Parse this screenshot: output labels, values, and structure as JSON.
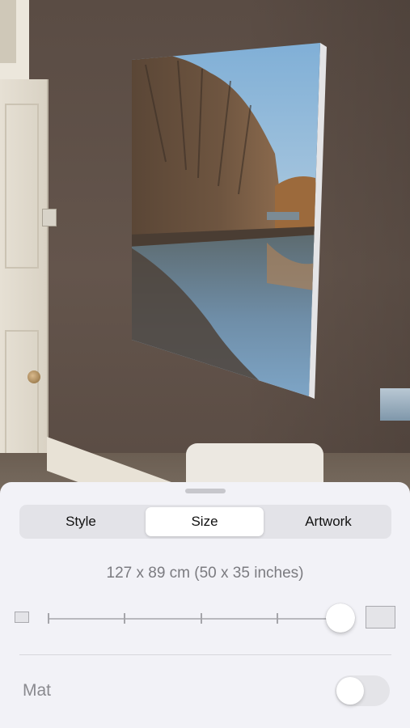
{
  "tabs": [
    {
      "label": "Style",
      "selected": false
    },
    {
      "label": "Size",
      "selected": true
    },
    {
      "label": "Artwork",
      "selected": false
    }
  ],
  "size": {
    "label": "127 x 89 cm (50 x 35 inches)",
    "slider_value": 1.0,
    "slider_steps": 5
  },
  "mat": {
    "label": "Mat",
    "enabled": false
  },
  "icons": {
    "min_size": "small-frame-icon",
    "max_size": "large-frame-icon"
  },
  "colors": {
    "sheet_background": "#f2f2f7",
    "segment_active": "#ffffff"
  }
}
